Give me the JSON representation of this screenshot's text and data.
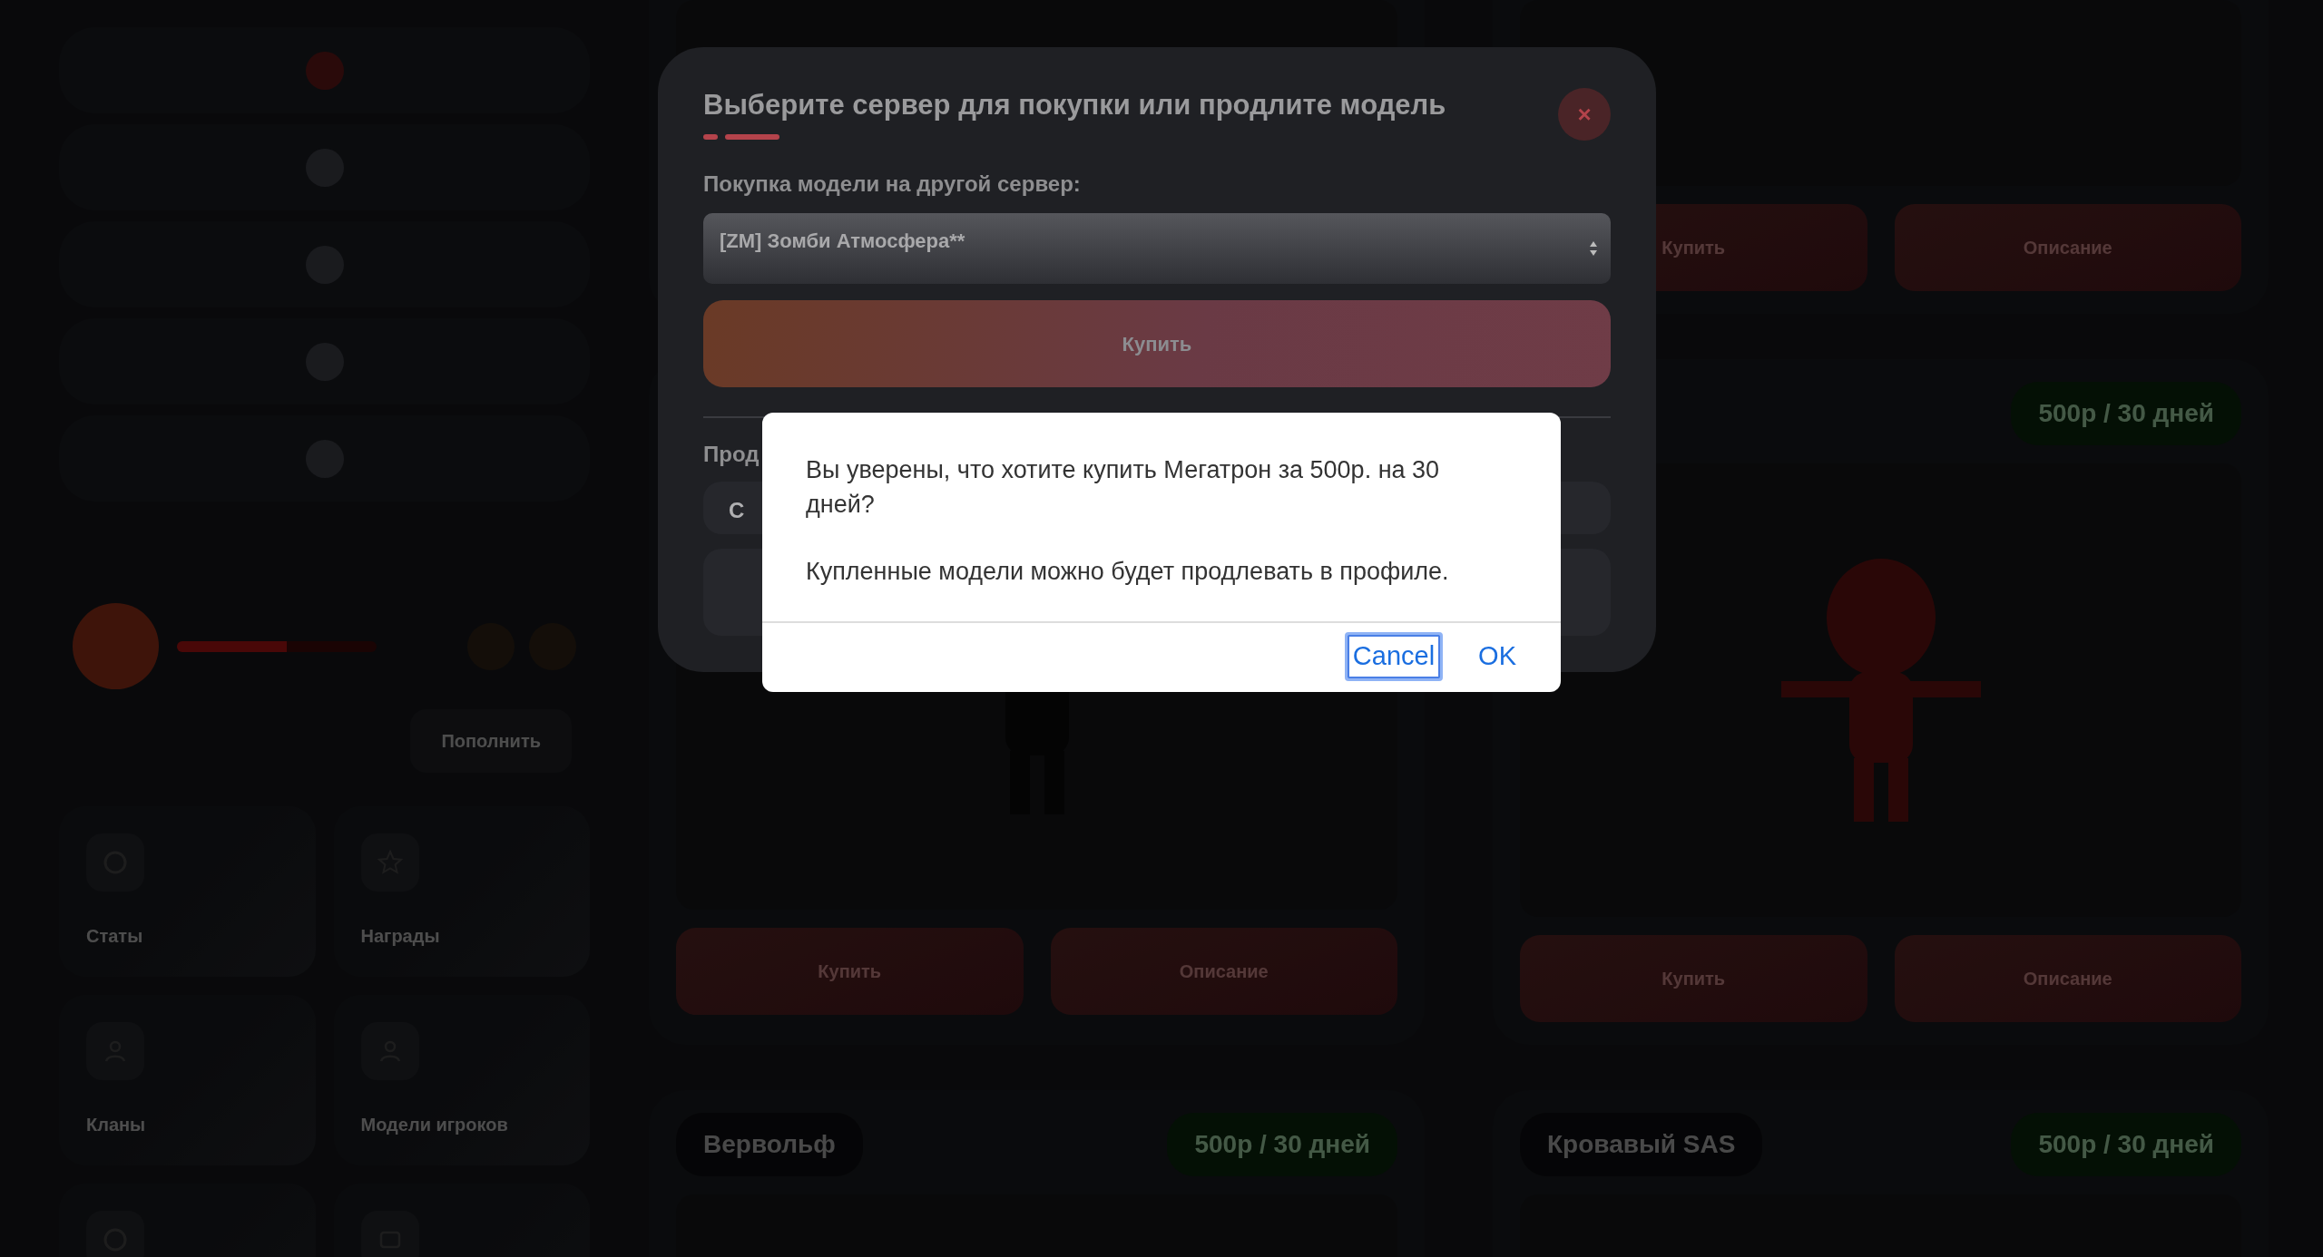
{
  "sidebar": {
    "progress": {
      "level": 0.55
    },
    "balance_button": "Пополнить",
    "tiles": [
      {
        "label": "Статы",
        "kind": "ring"
      },
      {
        "label": "Награды",
        "kind": "star"
      },
      {
        "label": "Кланы",
        "kind": "person"
      },
      {
        "label": "Модели игроков",
        "kind": "person"
      },
      {
        "kind": "ring"
      },
      {
        "kind": "square"
      }
    ]
  },
  "models": [
    {
      "buttons": [
        "Купить",
        "Описание"
      ]
    },
    {
      "buttons": [
        "Купить",
        "Описание"
      ]
    },
    {
      "price": "500р / 30 дней",
      "buttons": [
        "Купить",
        "Описание"
      ]
    },
    {
      "name": "Вервольф",
      "price": "500р / 30 дней"
    },
    {
      "name": "Кровавый SAS",
      "price": "500р / 30 дней"
    }
  ],
  "modal": {
    "title": "Выберите сервер для покупки или продлите модель",
    "close": "×",
    "section_label": "Покупка модели на другой сервер:",
    "server_select": "[ZM] Зомби Атмосфера**",
    "buy_button": "Купить",
    "second_label": "Прод",
    "second_field": "С"
  },
  "dialog": {
    "messages": [
      "Вы уверены, что хотите купить Мегатрон за 500р. на 30 дней?",
      "Купленные модели можно будет продлевать в профиле."
    ],
    "buttons": [
      {
        "label": "Cancel",
        "focused": true
      },
      {
        "label": "OK",
        "focused": false
      }
    ]
  }
}
